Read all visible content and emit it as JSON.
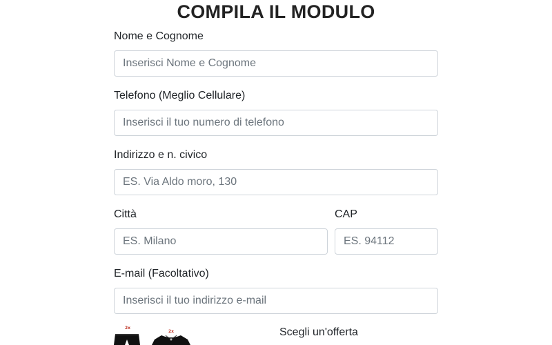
{
  "form": {
    "title": "COMPILA IL MODULO",
    "name": {
      "label": "Nome e Cognome",
      "placeholder": "Inserisci Nome e Cognome"
    },
    "phone": {
      "label": "Telefono (Meglio Cellulare)",
      "placeholder": "Inserisci il tuo numero di telefono"
    },
    "address": {
      "label": "Indirizzo e n. civico",
      "placeholder": "ES. Via Aldo moro, 130"
    },
    "city": {
      "label": "Città",
      "placeholder": "ES. Milano"
    },
    "cap": {
      "label": "CAP",
      "placeholder": "ES. 94112"
    },
    "email": {
      "label": "E-mail (Facoltativo)",
      "placeholder": "Inserisci il tuo indirizzo e-mail"
    },
    "offer": {
      "label": "Scegli un'offerta",
      "products": [
        {
          "badge": "2x",
          "icon": "black-shorts-icon"
        },
        {
          "badge": "2x",
          "icon": "black-top-icon"
        }
      ]
    }
  }
}
